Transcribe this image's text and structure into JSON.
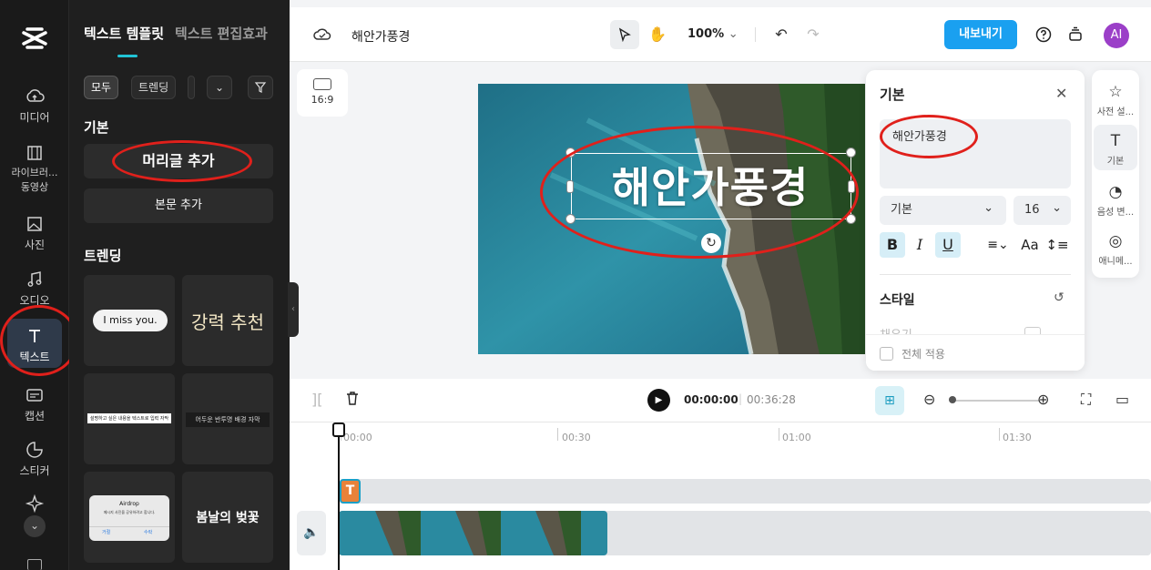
{
  "rail": {
    "items": [
      {
        "label": "미디어",
        "icon": "cloud-upload-icon"
      },
      {
        "label": "라이브러... 동영상",
        "icon": "film-icon"
      },
      {
        "label": "사진",
        "icon": "image-icon"
      },
      {
        "label": "오디오",
        "icon": "music-icon"
      },
      {
        "label": "텍스트",
        "icon": "text-icon"
      },
      {
        "label": "캡션",
        "icon": "caption-icon"
      },
      {
        "label": "스티커",
        "icon": "sticker-icon"
      }
    ]
  },
  "panel": {
    "tabs": [
      "텍스트 템플릿",
      "텍스트 편집효과"
    ],
    "chips": [
      "모두",
      "트렌딩"
    ],
    "basic_title": "기본",
    "add_heading": "머리글 추가",
    "add_body": "본문 추가",
    "trending_title": "트렌딩",
    "tiles": [
      {
        "text": "I miss you."
      },
      {
        "text": "강력 추천"
      },
      {
        "text": "설명하고 싶은 내용을 텍스트로 입력 자막"
      },
      {
        "text": "어두운 반투명 배경 자막"
      },
      {
        "text": "Airdrop",
        "sub": "메시지 사진을 공유하려고 합니다.",
        "btn1": "거절",
        "btn2": "수락"
      },
      {
        "text": "봄날의 벚꽃"
      }
    ]
  },
  "topbar": {
    "project_name": "해안가풍경",
    "zoom": "100%",
    "export_label": "내보내기",
    "avatar": "AI"
  },
  "canvas": {
    "ratio_label": "16:9",
    "title_text": "해안가풍경"
  },
  "props": {
    "title": "기본",
    "text_value": "해안가풍경",
    "font": "기본",
    "size": "16",
    "style_title": "스타일",
    "fill_label": "채우기",
    "apply_all": "전체 적용"
  },
  "rrail": {
    "items": [
      "사전 설...",
      "기본",
      "음성 변...",
      "애니메..."
    ]
  },
  "timeline": {
    "time_current": "00:00:00",
    "time_total": "00:36:28",
    "ruler": [
      "00:00",
      "00:30",
      "01:00",
      "01:30"
    ],
    "text_clip_label": "T"
  },
  "colors": {
    "accent": "#1aa0f0",
    "annotation": "#e0201b"
  }
}
